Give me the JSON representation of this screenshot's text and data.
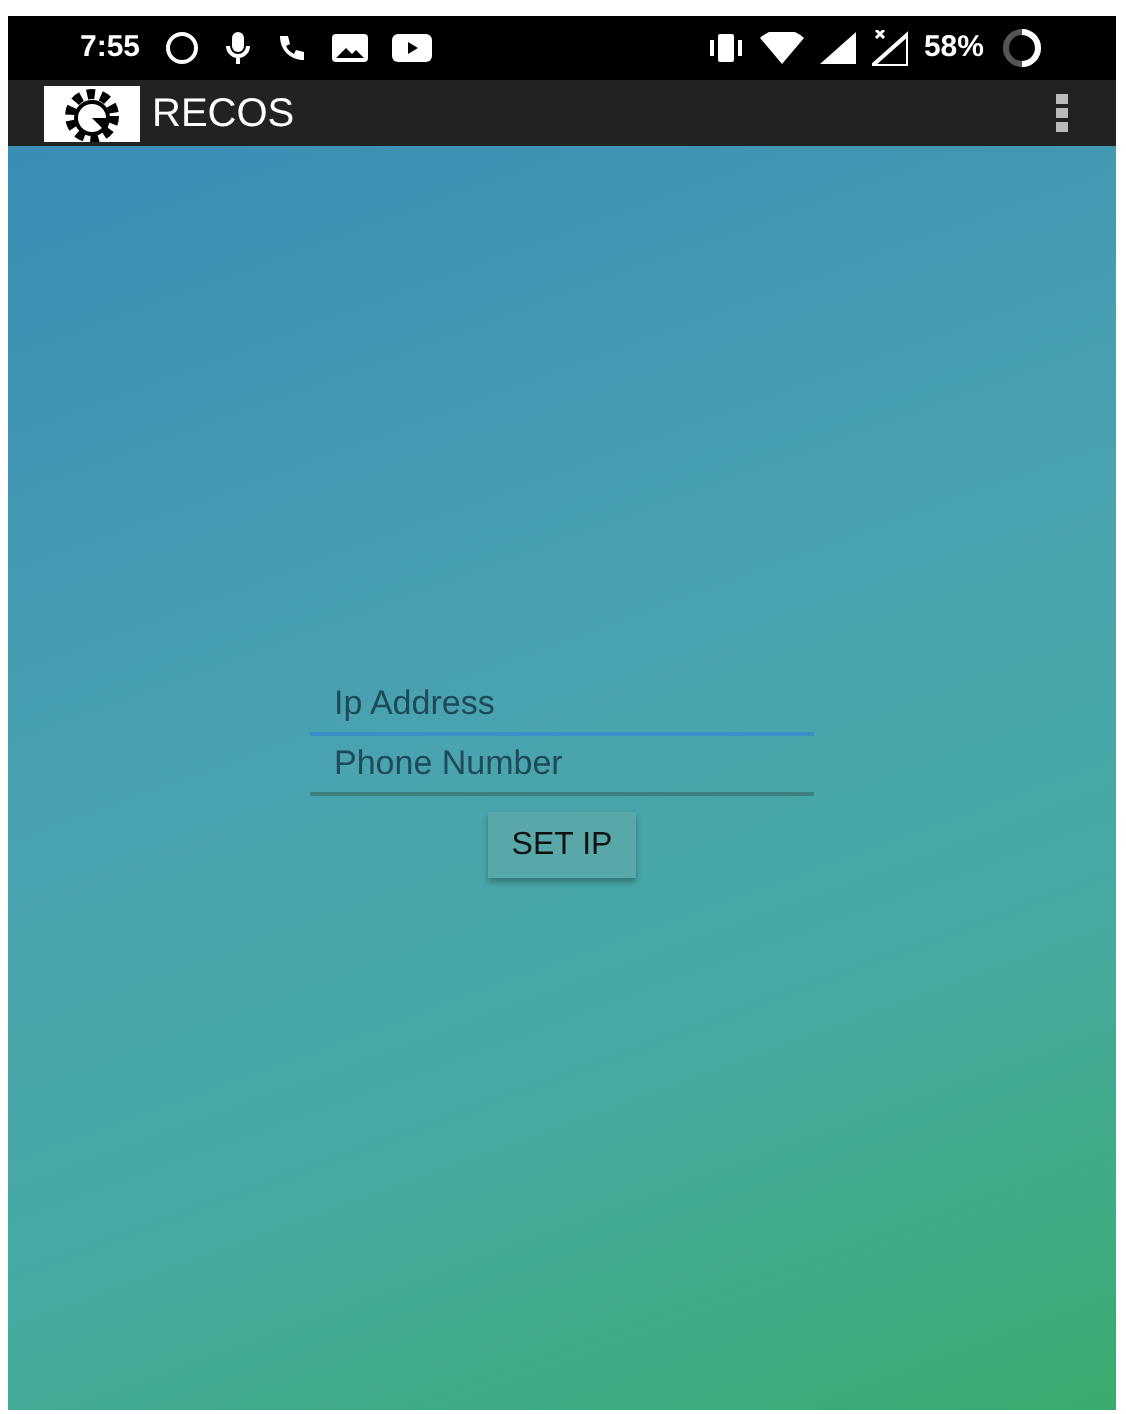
{
  "status_bar": {
    "time": "7:55",
    "battery": "58%"
  },
  "app_bar": {
    "title": "RECOS"
  },
  "fields": [
    {
      "placeholder": "Ip Address",
      "focused": true
    },
    {
      "placeholder": "Phone Number",
      "focused": false
    }
  ],
  "button": {
    "label": "SET IP"
  }
}
